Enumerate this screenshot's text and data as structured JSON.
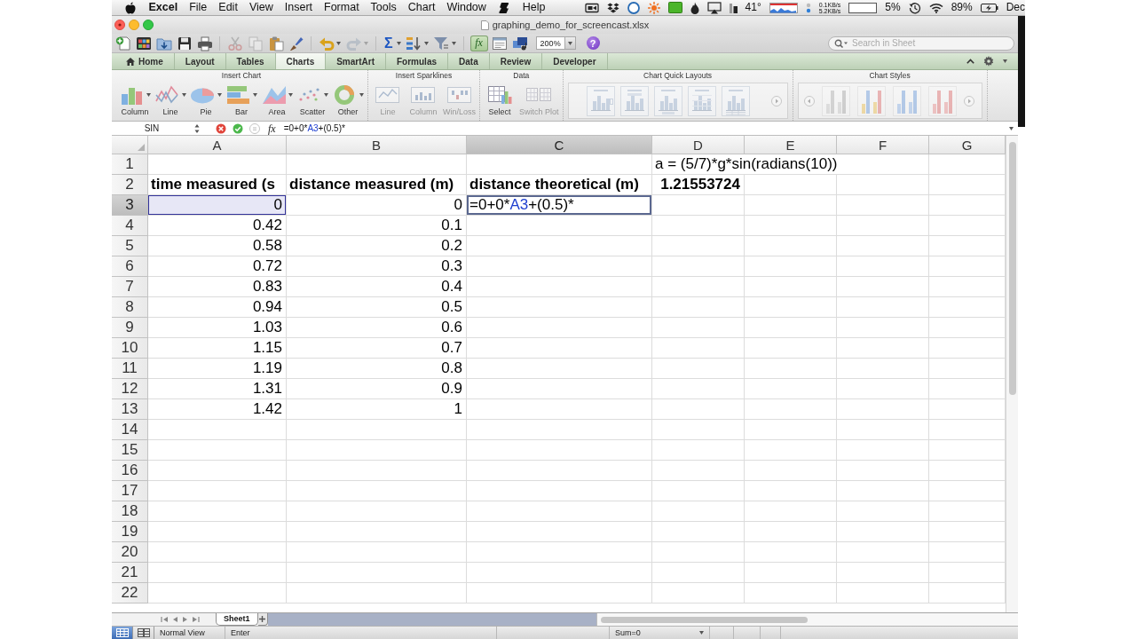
{
  "menu_bar": {
    "items": [
      {
        "kind": "app",
        "label": "Excel"
      },
      {
        "kind": "menu",
        "label": "File"
      },
      {
        "kind": "menu",
        "label": "Edit"
      },
      {
        "kind": "menu",
        "label": "View"
      },
      {
        "kind": "menu",
        "label": "Insert"
      },
      {
        "kind": "menu",
        "label": "Format"
      },
      {
        "kind": "menu",
        "label": "Tools"
      },
      {
        "kind": "menu",
        "label": "Chart"
      },
      {
        "kind": "menu",
        "label": "Window"
      },
      {
        "kind": "script"
      },
      {
        "kind": "menu",
        "label": "Help"
      }
    ],
    "status": {
      "temperature": "41°",
      "upload": "0.1KB/s",
      "download": "5.2KB/s",
      "cpu": "5%",
      "battery": "89%",
      "clock": "Dec"
    }
  },
  "window": {
    "title": "graphing_demo_for_screencast.xlsx"
  },
  "toolbar": {
    "groups": [
      {
        "buttons": [
          {
            "kind": "new",
            "disabled": false,
            "on": false
          },
          {
            "kind": "gallery",
            "disabled": false,
            "on": false
          },
          {
            "kind": "open",
            "disabled": false,
            "on": false
          },
          {
            "kind": "save",
            "disabled": false,
            "on": false
          },
          {
            "kind": "print",
            "disabled": false,
            "on": false
          }
        ]
      },
      {
        "buttons": [
          {
            "kind": "cut",
            "disabled": true,
            "on": false
          },
          {
            "kind": "copy",
            "disabled": true,
            "on": false
          },
          {
            "kind": "paste",
            "disabled": false,
            "on": false
          },
          {
            "kind": "brush",
            "disabled": false,
            "on": false
          }
        ]
      },
      {
        "buttons": [
          {
            "kind": "undo",
            "disabled": false,
            "on": false
          },
          {
            "kind": "redo",
            "disabled": true,
            "on": false
          }
        ]
      },
      {
        "buttons": [
          {
            "kind": "sum",
            "label": "Σ",
            "disabled": false,
            "on": false
          },
          {
            "kind": "sort",
            "disabled": false,
            "on": false
          },
          {
            "kind": "filter",
            "disabled": false,
            "on": false
          }
        ]
      },
      {
        "buttons": [
          {
            "kind": "formula",
            "label": "fx",
            "disabled": false,
            "on": true
          },
          {
            "kind": "toolbox",
            "disabled": false,
            "on": false
          },
          {
            "kind": "media",
            "disabled": false,
            "on": false
          }
        ]
      }
    ],
    "zoom": "200%",
    "help": {
      "label": "?"
    },
    "search": {
      "placeholder": "Search in Sheet"
    }
  },
  "ribbon": {
    "tabs": [
      {
        "label": "Home",
        "selected": false
      },
      {
        "label": "Layout",
        "selected": false
      },
      {
        "label": "Tables",
        "selected": false
      },
      {
        "label": "Charts",
        "selected": true
      },
      {
        "label": "SmartArt",
        "selected": false
      },
      {
        "label": "Formulas",
        "selected": false
      },
      {
        "label": "Data",
        "selected": false
      },
      {
        "label": "Review",
        "selected": false
      },
      {
        "label": "Developer",
        "selected": false
      }
    ],
    "groups": [
      {
        "title": "Insert Chart",
        "kind": "buttons",
        "buttons": [
          {
            "kind": "column",
            "label": "Column",
            "disabled": false
          },
          {
            "kind": "line",
            "label": "Line",
            "disabled": false
          },
          {
            "kind": "pie",
            "label": "Pie",
            "disabled": false
          },
          {
            "kind": "bar",
            "label": "Bar",
            "disabled": false
          },
          {
            "kind": "area",
            "label": "Area",
            "disabled": false
          },
          {
            "kind": "scatter",
            "label": "Scatter",
            "disabled": false
          },
          {
            "kind": "other",
            "label": "Other",
            "disabled": false
          }
        ]
      },
      {
        "title": "Insert Sparklines",
        "kind": "buttons",
        "buttons": [
          {
            "kind": "spark_line",
            "label": "Line",
            "disabled": true
          },
          {
            "kind": "spark_column",
            "label": "Column",
            "disabled": true
          },
          {
            "kind": "win_loss",
            "label": "Win/Loss",
            "disabled": true
          }
        ]
      },
      {
        "title": "Data",
        "kind": "buttons",
        "buttons": [
          {
            "kind": "select",
            "label": "Select",
            "disabled": false
          },
          {
            "kind": "switch",
            "label": "Switch Plot",
            "disabled": true
          }
        ]
      },
      {
        "title": "Chart Quick Layouts",
        "kind": "layouts",
        "disabled": true
      },
      {
        "title": "Chart Styles",
        "kind": "styles",
        "disabled": true
      }
    ]
  },
  "formula_bar": {
    "name_box": "SIN",
    "function_label": "fx",
    "formula": [
      {
        "kind": "plain",
        "text": "=0+0*"
      },
      {
        "kind": "reference",
        "text": "A3"
      },
      {
        "kind": "plain",
        "text": "+(0.5)*"
      }
    ]
  },
  "sheet": {
    "columns": [
      {
        "label": "A",
        "selected": false
      },
      {
        "label": "B",
        "selected": false
      },
      {
        "label": "C",
        "selected": true
      },
      {
        "label": "D",
        "selected": false
      },
      {
        "label": "E",
        "selected": false
      },
      {
        "label": "F",
        "selected": false
      },
      {
        "label": "G",
        "selected": false
      }
    ],
    "rows": [
      {
        "label": "1",
        "selected": false,
        "cells": {
          "d": {
            "kind": "text",
            "text": "a = (5/7)*g*sin(radians(10))",
            "bold": false,
            "highlighted": false
          }
        }
      },
      {
        "label": "2",
        "selected": false,
        "cells": {
          "a": {
            "kind": "text",
            "text": "time measured (s",
            "bold": true,
            "highlighted": false
          },
          "b": {
            "kind": "text",
            "text": "distance measured (m)",
            "bold": true,
            "highlighted": false
          },
          "c": {
            "kind": "text",
            "text": "distance theoretical (m)",
            "bold": true,
            "highlighted": false
          },
          "d": {
            "kind": "number",
            "text": "1.21553724",
            "bold": true,
            "highlighted": false
          }
        }
      },
      {
        "label": "3",
        "selected": true,
        "cells": {
          "a": {
            "kind": "number",
            "text": "0",
            "bold": false,
            "highlighted": true
          },
          "b": {
            "kind": "number",
            "text": "0",
            "bold": false,
            "highlighted": false
          },
          "c": {
            "kind": "editing",
            "segments": [
              {
                "kind": "plain",
                "text": "=0+0*"
              },
              {
                "kind": "reference",
                "text": "A3"
              },
              {
                "kind": "plain",
                "text": "+(0.5)*"
              }
            ],
            "bold": false,
            "highlighted": false
          }
        }
      },
      {
        "label": "4",
        "selected": false,
        "cells": {
          "a": {
            "kind": "number",
            "text": "0.42",
            "bold": false,
            "highlighted": false
          },
          "b": {
            "kind": "number",
            "text": "0.1",
            "bold": false,
            "highlighted": false
          }
        }
      },
      {
        "label": "5",
        "selected": false,
        "cells": {
          "a": {
            "kind": "number",
            "text": "0.58",
            "bold": false,
            "highlighted": false
          },
          "b": {
            "kind": "number",
            "text": "0.2",
            "bold": false,
            "highlighted": false
          }
        }
      },
      {
        "label": "6",
        "selected": false,
        "cells": {
          "a": {
            "kind": "number",
            "text": "0.72",
            "bold": false,
            "highlighted": false
          },
          "b": {
            "kind": "number",
            "text": "0.3",
            "bold": false,
            "highlighted": false
          }
        }
      },
      {
        "label": "7",
        "selected": false,
        "cells": {
          "a": {
            "kind": "number",
            "text": "0.83",
            "bold": false,
            "highlighted": false
          },
          "b": {
            "kind": "number",
            "text": "0.4",
            "bold": false,
            "highlighted": false
          }
        }
      },
      {
        "label": "8",
        "selected": false,
        "cells": {
          "a": {
            "kind": "number",
            "text": "0.94",
            "bold": false,
            "highlighted": false
          },
          "b": {
            "kind": "number",
            "text": "0.5",
            "bold": false,
            "highlighted": false
          }
        }
      },
      {
        "label": "9",
        "selected": false,
        "cells": {
          "a": {
            "kind": "number",
            "text": "1.03",
            "bold": false,
            "highlighted": false
          },
          "b": {
            "kind": "number",
            "text": "0.6",
            "bold": false,
            "highlighted": false
          }
        }
      },
      {
        "label": "10",
        "selected": false,
        "cells": {
          "a": {
            "kind": "number",
            "text": "1.15",
            "bold": false,
            "highlighted": false
          },
          "b": {
            "kind": "number",
            "text": "0.7",
            "bold": false,
            "highlighted": false
          }
        }
      },
      {
        "label": "11",
        "selected": false,
        "cells": {
          "a": {
            "kind": "number",
            "text": "1.19",
            "bold": false,
            "highlighted": false
          },
          "b": {
            "kind": "number",
            "text": "0.8",
            "bold": false,
            "highlighted": false
          }
        }
      },
      {
        "label": "12",
        "selected": false,
        "cells": {
          "a": {
            "kind": "number",
            "text": "1.31",
            "bold": false,
            "highlighted": false
          },
          "b": {
            "kind": "number",
            "text": "0.9",
            "bold": false,
            "highlighted": false
          }
        }
      },
      {
        "label": "13",
        "selected": false,
        "cells": {
          "a": {
            "kind": "number",
            "text": "1.42",
            "bold": false,
            "highlighted": false
          },
          "b": {
            "kind": "number",
            "text": "1",
            "bold": false,
            "highlighted": false
          }
        }
      },
      {
        "label": "14",
        "selected": false
      },
      {
        "label": "15",
        "selected": false
      },
      {
        "label": "16",
        "selected": false
      },
      {
        "label": "17",
        "selected": false
      },
      {
        "label": "18",
        "selected": false
      },
      {
        "label": "19",
        "selected": false
      },
      {
        "label": "20",
        "selected": false
      },
      {
        "label": "21",
        "selected": false
      },
      {
        "label": "22",
        "selected": false
      }
    ],
    "sheets": [
      {
        "label": "Sheet1",
        "selected": true
      }
    ]
  },
  "status_bar": {
    "views": [
      {
        "kind": "normal",
        "selected": true
      },
      {
        "kind": "page_layout",
        "selected": false
      }
    ],
    "view_label": "Normal View",
    "mode": "Enter",
    "sum": "Sum=0"
  }
}
